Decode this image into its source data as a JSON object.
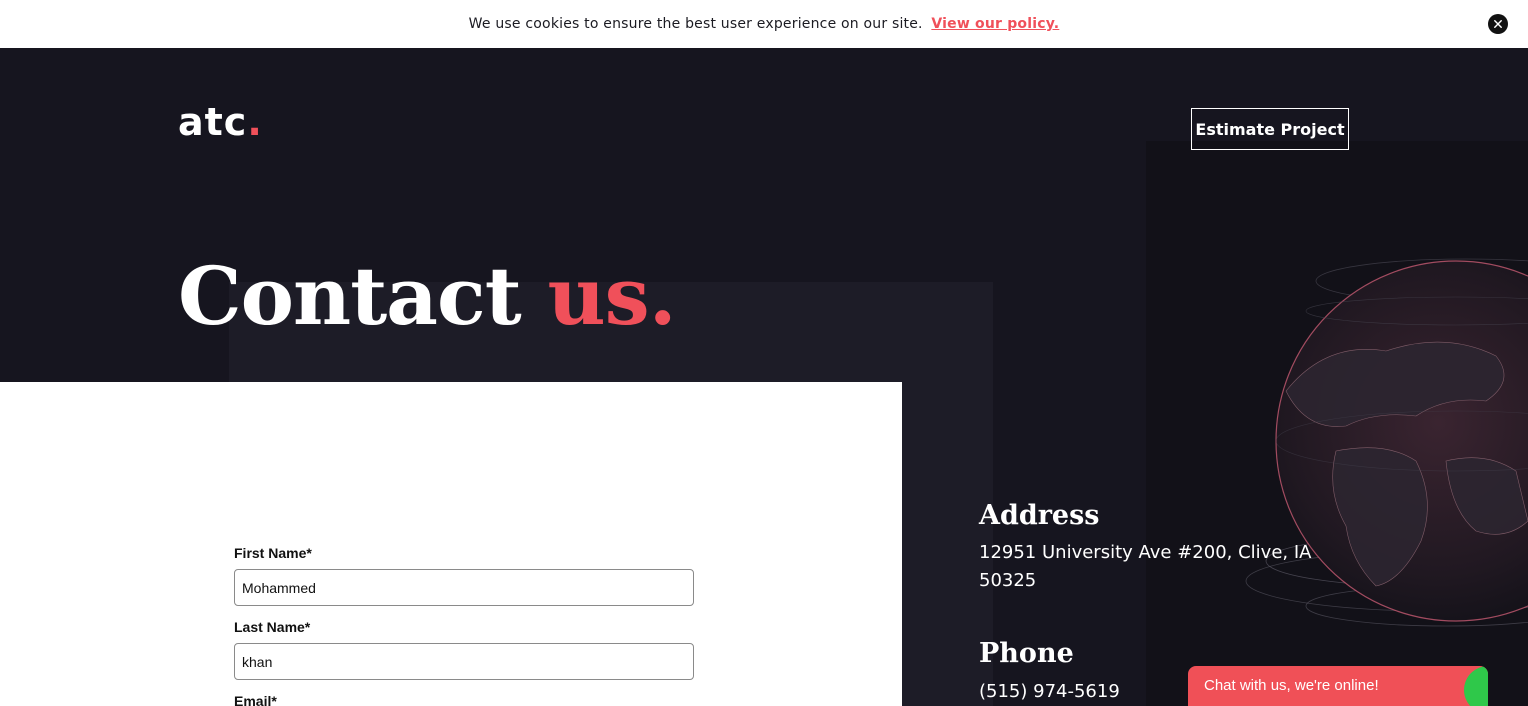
{
  "cookie_bar": {
    "message": "We use cookies to ensure the best user experience on our site.",
    "link_text": "View our policy."
  },
  "header": {
    "logo_text": "atc",
    "logo_dot": ".",
    "estimate_button": "Estimate Project"
  },
  "hero": {
    "title_main": "Contact ",
    "title_accent": "us."
  },
  "form": {
    "first_name": {
      "label": "First Name*",
      "value": "Mohammed"
    },
    "last_name": {
      "label": "Last Name*",
      "value": "khan"
    },
    "email": {
      "label": "Email*"
    }
  },
  "contact": {
    "address_heading": "Address",
    "address_text": "12951 University Ave #200, Clive, IA 50325",
    "phone_heading": "Phone",
    "phone_text": "(515) 974-5619"
  },
  "chat": {
    "label": "Chat with us, we're online!"
  },
  "colors": {
    "accent": "#f0505a",
    "background": "#16151f",
    "chat": "#f05057",
    "online": "#2fc84a"
  }
}
